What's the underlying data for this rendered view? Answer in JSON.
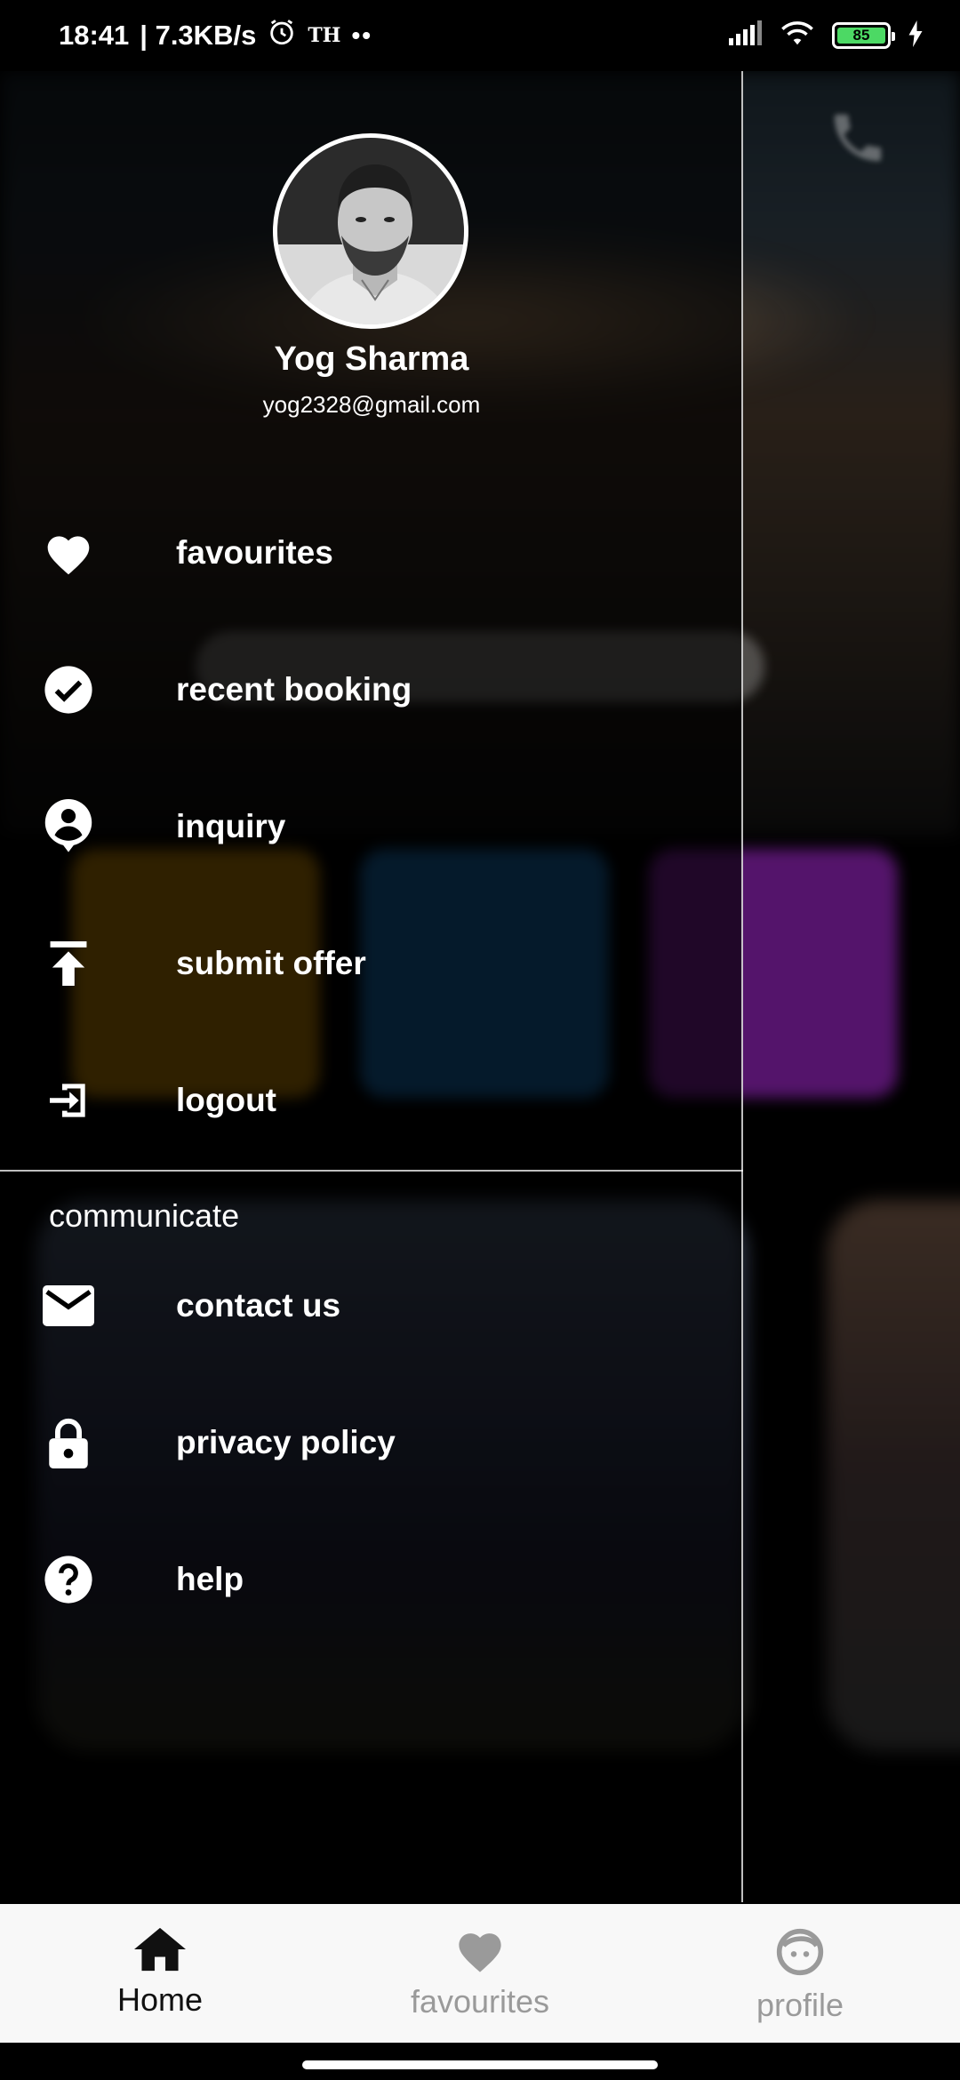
{
  "status_bar": {
    "time": "18:41",
    "network_speed": "| 7.3KB/s",
    "extra": "TH",
    "dots": "••",
    "battery": "85",
    "icons": [
      "alarm-icon",
      "signal-icon",
      "wifi-icon",
      "battery-icon",
      "charging-icon"
    ]
  },
  "drawer": {
    "profile": {
      "name": "Yog Sharma",
      "email": "yog2328@gmail.com"
    },
    "menu": [
      {
        "label": "favourites",
        "icon": "heart-icon"
      },
      {
        "label": "recent booking",
        "icon": "check-circle-icon"
      },
      {
        "label": "inquiry",
        "icon": "account-pin-icon"
      },
      {
        "label": "submit offer",
        "icon": "upload-icon"
      },
      {
        "label": "logout",
        "icon": "exit-icon"
      }
    ],
    "section_title": "communicate",
    "communicate": [
      {
        "label": "contact us",
        "icon": "mail-icon"
      },
      {
        "label": "privacy policy",
        "icon": "lock-icon"
      },
      {
        "label": "help",
        "icon": "help-icon"
      }
    ]
  },
  "bottom_nav": {
    "items": [
      {
        "label": "Home",
        "icon": "home-icon",
        "active": true
      },
      {
        "label": "favourites",
        "icon": "heart-icon",
        "active": false
      },
      {
        "label": "profile",
        "icon": "face-icon",
        "active": false
      }
    ]
  },
  "colors": {
    "battery_fill": "#4cd964",
    "nav_active": "#111111",
    "nav_inactive": "#9a9a9a"
  }
}
